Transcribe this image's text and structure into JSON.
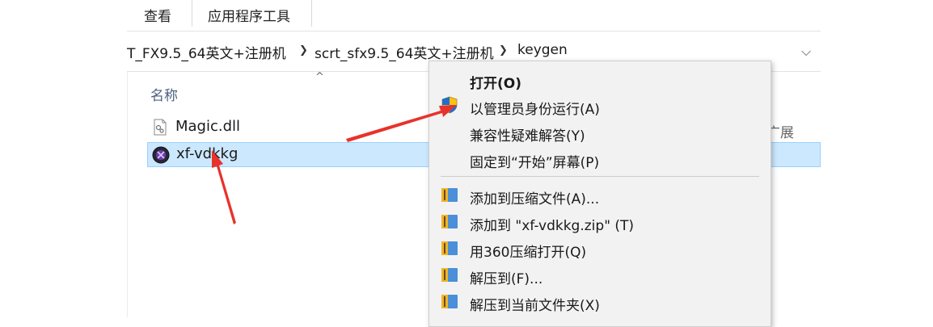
{
  "ribbon": {
    "tab_view": "查看",
    "tab_apptools": "应用程序工具"
  },
  "address_bar": {
    "crumbs": [
      "T_FX9.5_64英文+注册机",
      "scrt_sfx9.5_64英文+注册机",
      "keygen"
    ]
  },
  "columns": {
    "name": "名称",
    "partial_right": "广展"
  },
  "files": [
    {
      "name": "Magic.dll",
      "icon": "dll-file-icon",
      "selected": false
    },
    {
      "name": "xf-vdkkg",
      "icon": "keygen-app-icon",
      "selected": true
    }
  ],
  "context_menu": {
    "items": [
      {
        "label": "打开(O)",
        "bold": true
      },
      {
        "label": "以管理员身份运行(A)",
        "icon": "uac-shield-icon"
      },
      {
        "label": "兼容性疑难解答(Y)"
      },
      {
        "label": "固定到“开始”屏幕(P)"
      },
      {
        "label": "添加到压缩文件(A)...",
        "icon": "winrar-archive-icon"
      },
      {
        "label": "添加到 \"xf-vdkkg.zip\" (T)",
        "icon": "winrar-archive-icon"
      },
      {
        "label": "用360压缩打开(Q)",
        "icon": "winrar-archive-icon"
      },
      {
        "label": "解压到(F)...",
        "icon": "winrar-archive-icon"
      },
      {
        "label": "解压到当前文件夹(X)",
        "icon": "winrar-archive-icon"
      }
    ]
  },
  "colors": {
    "selection_bg": "#cce8ff",
    "selection_border": "#99d1ff",
    "annotation_arrow": "#e8322b",
    "menu_bg": "#f2f2f2"
  }
}
